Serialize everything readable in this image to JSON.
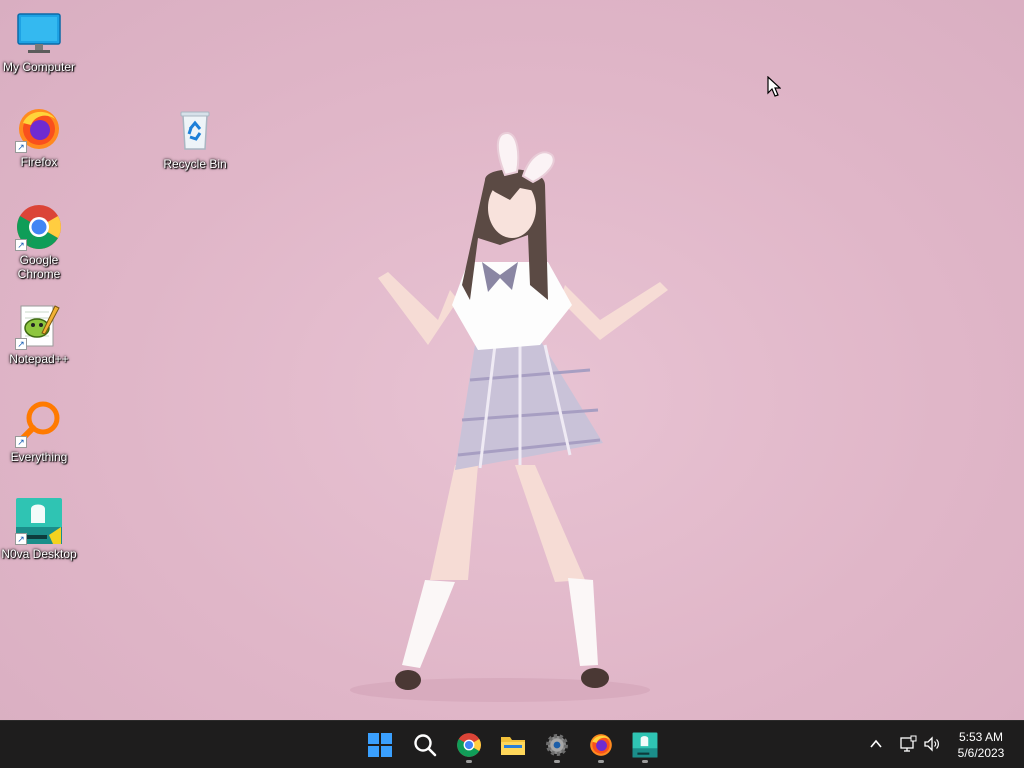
{
  "desktop": {
    "background_color": "#e2b9ca",
    "icons": [
      {
        "label": "My Computer",
        "icon": "monitor-icon"
      },
      {
        "label": "Firefox",
        "icon": "firefox-icon"
      },
      {
        "label": "Recycle Bin",
        "icon": "recycle-bin-icon"
      },
      {
        "label": "Google Chrome",
        "icon": "chrome-icon"
      },
      {
        "label": "Notepad++",
        "icon": "notepad-plus-plus-icon"
      },
      {
        "label": "Everything",
        "icon": "everything-search-icon"
      },
      {
        "label": "N0va Desktop",
        "icon": "n0va-desktop-icon"
      }
    ]
  },
  "taskbar": {
    "background_color": "#1e1d1d",
    "pinned": [
      {
        "name": "Start",
        "icon": "windows-start-icon"
      },
      {
        "name": "Search",
        "icon": "search-icon"
      },
      {
        "name": "Google Chrome",
        "icon": "chrome-icon"
      },
      {
        "name": "File Explorer",
        "icon": "folder-icon"
      },
      {
        "name": "Settings",
        "icon": "gear-icon"
      },
      {
        "name": "Firefox",
        "icon": "firefox-icon"
      },
      {
        "name": "N0va Desktop",
        "icon": "n0va-desktop-icon"
      }
    ],
    "tray": {
      "overflow_icon": "chevron-up-icon",
      "network_icon": "network-icon",
      "volume_icon": "speaker-icon"
    },
    "clock": {
      "time": "5:53 AM",
      "date": "5/6/2023"
    }
  }
}
